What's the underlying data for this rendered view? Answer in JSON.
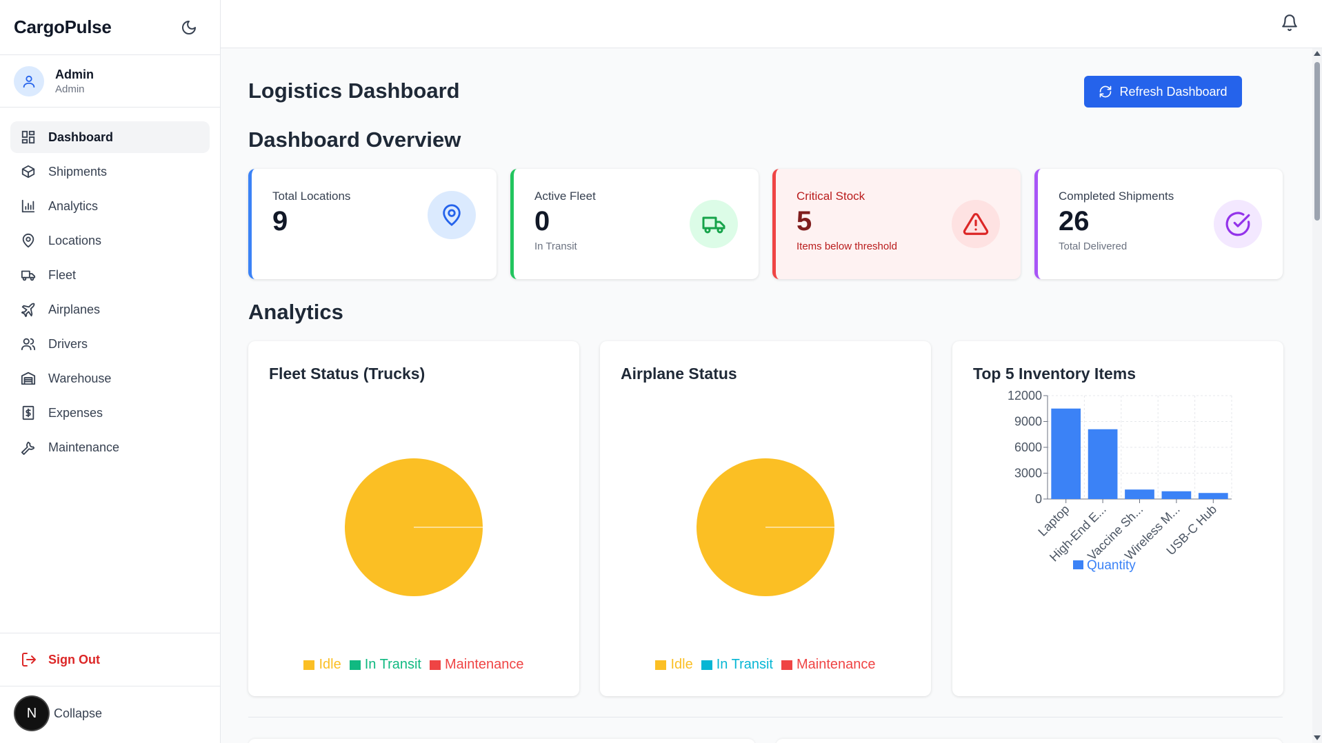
{
  "app": {
    "brand": "CargoPulse"
  },
  "user": {
    "name": "Admin",
    "role": "Admin"
  },
  "sidebar": {
    "items": [
      {
        "label": "Dashboard",
        "icon": "dashboard-grid-icon",
        "active": true
      },
      {
        "label": "Shipments",
        "icon": "box-icon"
      },
      {
        "label": "Analytics",
        "icon": "bar-chart-icon"
      },
      {
        "label": "Locations",
        "icon": "map-pin-icon"
      },
      {
        "label": "Fleet",
        "icon": "truck-icon"
      },
      {
        "label": "Airplanes",
        "icon": "airplane-icon"
      },
      {
        "label": "Drivers",
        "icon": "users-icon"
      },
      {
        "label": "Warehouse",
        "icon": "warehouse-icon"
      },
      {
        "label": "Expenses",
        "icon": "receipt-dollar-icon"
      },
      {
        "label": "Maintenance",
        "icon": "wrench-icon"
      }
    ],
    "sign_out": "Sign Out",
    "collapse": "Collapse",
    "collapse_badge": "N"
  },
  "header": {
    "title": "Logistics Dashboard",
    "refresh_label": "Refresh Dashboard"
  },
  "overview": {
    "title": "Dashboard Overview",
    "cards": [
      {
        "label": "Total Locations",
        "value": "9",
        "sub": "",
        "accent": "#3b82f6",
        "icon": "map-pin-icon"
      },
      {
        "label": "Active Fleet",
        "value": "0",
        "sub": "In Transit",
        "accent": "#22c55e",
        "icon": "truck-icon"
      },
      {
        "label": "Critical Stock",
        "value": "5",
        "sub": "Items below threshold",
        "accent": "#ef4444",
        "icon": "warning-triangle-icon"
      },
      {
        "label": "Completed Shipments",
        "value": "26",
        "sub": "Total Delivered",
        "accent": "#a855f7",
        "icon": "check-circle-icon"
      }
    ]
  },
  "analytics": {
    "title": "Analytics",
    "fleet_title": "Fleet Status (Trucks)",
    "airplane_title": "Airplane Status",
    "inventory_title": "Top 5 Inventory Items"
  },
  "chart_data": [
    {
      "type": "pie",
      "title": "Fleet Status (Trucks)",
      "categories": [
        "Idle",
        "In Transit",
        "Maintenance"
      ],
      "values": [
        1,
        0,
        0
      ],
      "colors": [
        "#fbbf24",
        "#10b981",
        "#ef4444"
      ],
      "legend": "bottom"
    },
    {
      "type": "pie",
      "title": "Airplane Status",
      "categories": [
        "Idle",
        "In Transit",
        "Maintenance"
      ],
      "values": [
        1,
        0,
        0
      ],
      "colors": [
        "#fbbf24",
        "#06b6d4",
        "#ef4444"
      ],
      "legend": "bottom"
    },
    {
      "type": "bar",
      "title": "Top 5 Inventory Items",
      "categories": [
        "Laptop",
        "High-End E...",
        "Vaccine Sh...",
        "Wireless M...",
        "USB-C Hub"
      ],
      "series": [
        {
          "name": "Quantity",
          "values": [
            10500,
            8100,
            1100,
            900,
            700
          ],
          "color": "#3b82f6"
        }
      ],
      "yticks": [
        0,
        3000,
        6000,
        9000,
        12000
      ],
      "ylim": [
        0,
        12000
      ],
      "grid": true,
      "legend": "bottom"
    }
  ]
}
